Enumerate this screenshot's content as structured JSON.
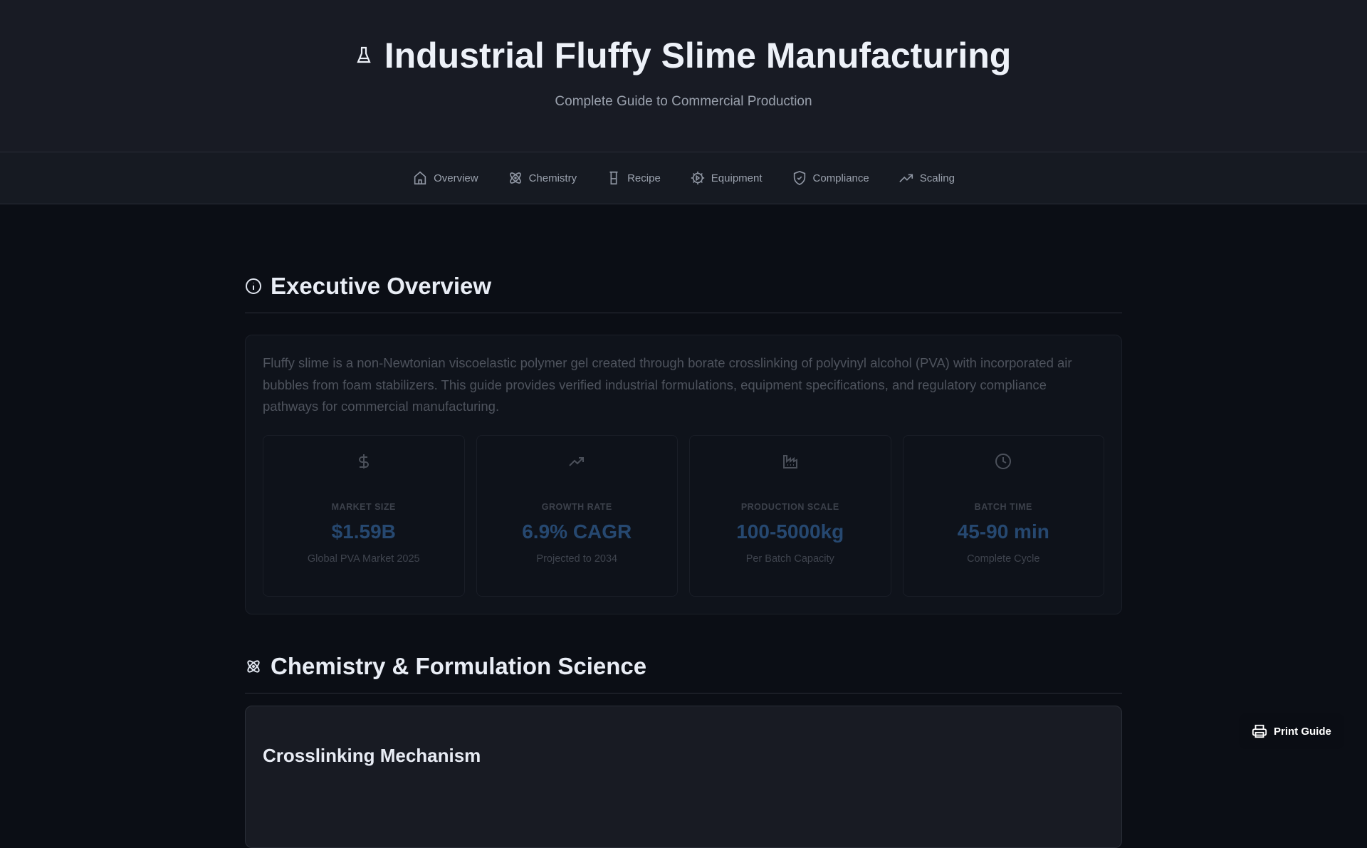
{
  "header": {
    "title": "Industrial Fluffy Slime Manufacturing",
    "subtitle": "Complete Guide to Commercial Production"
  },
  "nav": [
    {
      "label": "Overview",
      "icon": "home-icon"
    },
    {
      "label": "Chemistry",
      "icon": "atom-icon"
    },
    {
      "label": "Recipe",
      "icon": "beaker-icon"
    },
    {
      "label": "Equipment",
      "icon": "gear-icon"
    },
    {
      "label": "Compliance",
      "icon": "shield-check-icon"
    },
    {
      "label": "Scaling",
      "icon": "trending-up-icon"
    }
  ],
  "overview": {
    "heading": "Executive Overview",
    "text": "Fluffy slime is a non-Newtonian viscoelastic polymer gel created through borate crosslinking of polyvinyl alcohol (PVA) with incorporated air bubbles from foam stabilizers. This guide provides verified industrial formulations, equipment specifications, and regulatory compliance pathways for commercial manufacturing.",
    "stats": [
      {
        "label": "MARKET SIZE",
        "value": "$1.59B",
        "sub": "Global PVA Market 2025"
      },
      {
        "label": "GROWTH RATE",
        "value": "6.9% CAGR",
        "sub": "Projected to 2034"
      },
      {
        "label": "PRODUCTION SCALE",
        "value": "100-5000kg",
        "sub": "Per Batch Capacity"
      },
      {
        "label": "BATCH TIME",
        "value": "45-90 min",
        "sub": "Complete Cycle"
      }
    ]
  },
  "chemistry": {
    "heading": "Chemistry & Formulation Science",
    "subheading": "Crosslinking Mechanism"
  },
  "print_label": "Print Guide"
}
